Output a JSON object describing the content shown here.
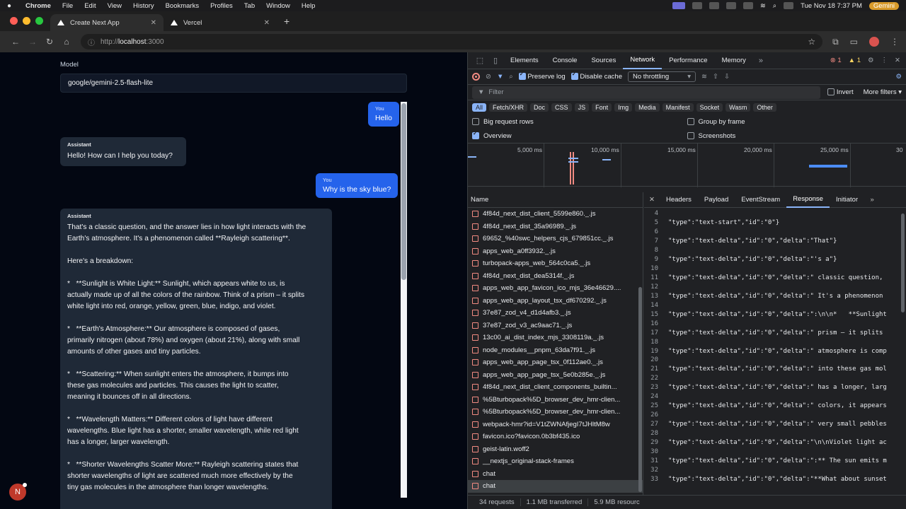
{
  "menubar": {
    "app": "Chrome",
    "items": [
      "File",
      "Edit",
      "View",
      "History",
      "Bookmarks",
      "Profiles",
      "Tab",
      "Window",
      "Help"
    ],
    "clock": "Tue Nov 18  7:37 PM",
    "badge": "Gemini"
  },
  "tabs": [
    {
      "title": "Create Next App",
      "active": true
    },
    {
      "title": "Vercel",
      "active": false
    }
  ],
  "address": {
    "scheme": "http://",
    "host": "localhost",
    "port": ":3000"
  },
  "chat": {
    "model_label": "Model",
    "model_value": "google/gemini-2.5-flash-lite",
    "you_label": "You",
    "assistant_label": "Assistant",
    "messages": [
      {
        "role": "user",
        "text": "Hello"
      },
      {
        "role": "assistant",
        "text": "Hello! How can I help you today?"
      },
      {
        "role": "user",
        "text": "Why is the sky blue?"
      },
      {
        "role": "assistant",
        "text": "That's a classic question, and the answer lies in how light interacts with the\nEarth's atmosphere. It's a phenomenon called **Rayleigh scattering**.\n\nHere's a breakdown:\n\n*   **Sunlight is White Light:** Sunlight, which appears white to us, is\nactually made up of all the colors of the rainbow. Think of a prism – it splits\nwhite light into red, orange, yellow, green, blue, indigo, and violet.\n\n*   **Earth's Atmosphere:** Our atmosphere is composed of gases,\nprimarily nitrogen (about 78%) and oxygen (about 21%), along with small\namounts of other gases and tiny particles.\n\n*   **Scattering:** When sunlight enters the atmosphere, it bumps into\nthese gas molecules and particles. This causes the light to scatter,\nmeaning it bounces off in all directions.\n\n*   **Wavelength Matters:** Different colors of light have different\nwavelengths. Blue light has a shorter, smaller wavelength, while red light\nhas a longer, larger wavelength.\n\n*   **Shorter Wavelengths Scatter More:** Rayleigh scattering states that\nshorter wavelengths of light are scattered much more effectively by the\ntiny gas molecules in the atmosphere than longer wavelengths."
      }
    ],
    "user_badge": "N"
  },
  "devtools": {
    "panels": [
      "Elements",
      "Console",
      "Sources",
      "Network",
      "Performance",
      "Memory"
    ],
    "active_panel": "Network",
    "error_count": "1",
    "warn_count": "1",
    "toolbar": {
      "preserve_log": "Preserve log",
      "disable_cache": "Disable cache",
      "throttling": "No throttling"
    },
    "filter": {
      "placeholder": "Filter",
      "invert": "Invert",
      "more_filters": "More filters"
    },
    "types": [
      "All",
      "Fetch/XHR",
      "Doc",
      "CSS",
      "JS",
      "Font",
      "Img",
      "Media",
      "Manifest",
      "Socket",
      "Wasm",
      "Other"
    ],
    "options": {
      "big_rows": "Big request rows",
      "group_by_frame": "Group by frame",
      "overview": "Overview",
      "screenshots": "Screenshots"
    },
    "timeline_ticks": [
      "5,000 ms",
      "10,000 ms",
      "15,000 ms",
      "20,000 ms",
      "25,000 ms",
      "30"
    ],
    "name_header": "Name",
    "requests": [
      "4f84d_next_dist_client_5599e860._.js",
      "4f84d_next_dist_35a96989._.js",
      "69652_%40swc_helpers_cjs_679851cc._.js",
      "apps_web_a0ff3932._.js",
      "turbopack-apps_web_564c0ca5._.js",
      "4f84d_next_dist_dea5314f._.js",
      "apps_web_app_favicon_ico_mjs_36e46629....",
      "apps_web_app_layout_tsx_df670292._.js",
      "37e87_zod_v4_d1d4afb3._.js",
      "37e87_zod_v3_ac9aac71._.js",
      "13c00_ai_dist_index_mjs_3308119a._.js",
      "node_modules__pnpm_63da7f91._.js",
      "apps_web_app_page_tsx_0f112ae0._.js",
      "apps_web_app_page_tsx_5e0b285e._.js",
      "4f84d_next_dist_client_components_builtin...",
      "%5Bturbopack%5D_browser_dev_hmr-clien...",
      "%5Bturbopack%5D_browser_dev_hmr-clien...",
      "webpack-hmr?id=V1tZWNAfjegI7tJHltM8w",
      "favicon.ico?favicon.0b3bf435.ico",
      "geist-latin.woff2",
      "__nextjs_original-stack-frames",
      "chat",
      "chat"
    ],
    "detail_tabs": [
      "Headers",
      "Payload",
      "EventStream",
      "Response",
      "Initiator"
    ],
    "active_detail_tab": "Response",
    "response_lines": [
      {
        "n": "4",
        "t": ""
      },
      {
        "n": "5",
        "t": "\"type\":\"text-start\",\"id\":\"0\"}"
      },
      {
        "n": "6",
        "t": ""
      },
      {
        "n": "7",
        "t": "\"type\":\"text-delta\",\"id\":\"0\",\"delta\":\"That\"}"
      },
      {
        "n": "8",
        "t": ""
      },
      {
        "n": "9",
        "t": "\"type\":\"text-delta\",\"id\":\"0\",\"delta\":\"'s a\"}"
      },
      {
        "n": "10",
        "t": ""
      },
      {
        "n": "11",
        "t": "\"type\":\"text-delta\",\"id\":\"0\",\"delta\":\" classic question,"
      },
      {
        "n": "12",
        "t": ""
      },
      {
        "n": "13",
        "t": "\"type\":\"text-delta\",\"id\":\"0\",\"delta\":\" It's a phenomenon"
      },
      {
        "n": "14",
        "t": ""
      },
      {
        "n": "15",
        "t": "\"type\":\"text-delta\",\"id\":\"0\",\"delta\":\":\\n\\n*   **Sunlight"
      },
      {
        "n": "16",
        "t": ""
      },
      {
        "n": "17",
        "t": "\"type\":\"text-delta\",\"id\":\"0\",\"delta\":\" prism – it splits"
      },
      {
        "n": "18",
        "t": ""
      },
      {
        "n": "19",
        "t": "\"type\":\"text-delta\",\"id\":\"0\",\"delta\":\" atmosphere is comp"
      },
      {
        "n": "20",
        "t": ""
      },
      {
        "n": "21",
        "t": "\"type\":\"text-delta\",\"id\":\"0\",\"delta\":\" into these gas mol"
      },
      {
        "n": "22",
        "t": ""
      },
      {
        "n": "23",
        "t": "\"type\":\"text-delta\",\"id\":\"0\",\"delta\":\" has a longer, larg"
      },
      {
        "n": "24",
        "t": ""
      },
      {
        "n": "25",
        "t": "\"type\":\"text-delta\",\"id\":\"0\",\"delta\":\" colors, it appears"
      },
      {
        "n": "26",
        "t": ""
      },
      {
        "n": "27",
        "t": "\"type\":\"text-delta\",\"id\":\"0\",\"delta\":\" very small pebbles"
      },
      {
        "n": "28",
        "t": ""
      },
      {
        "n": "29",
        "t": "\"type\":\"text-delta\",\"id\":\"0\",\"delta\":\"\\n\\nViolet light ac"
      },
      {
        "n": "30",
        "t": ""
      },
      {
        "n": "31",
        "t": "\"type\":\"text-delta\",\"id\":\"0\",\"delta\":\":** The sun emits m"
      },
      {
        "n": "32",
        "t": ""
      },
      {
        "n": "33",
        "t": "\"type\":\"text-delta\",\"id\":\"0\",\"delta\":\"**What about sunset"
      }
    ],
    "status": {
      "requests": "34 requests",
      "transferred": "1.1 MB transferred",
      "resources": "5.9 MB resourc"
    }
  }
}
